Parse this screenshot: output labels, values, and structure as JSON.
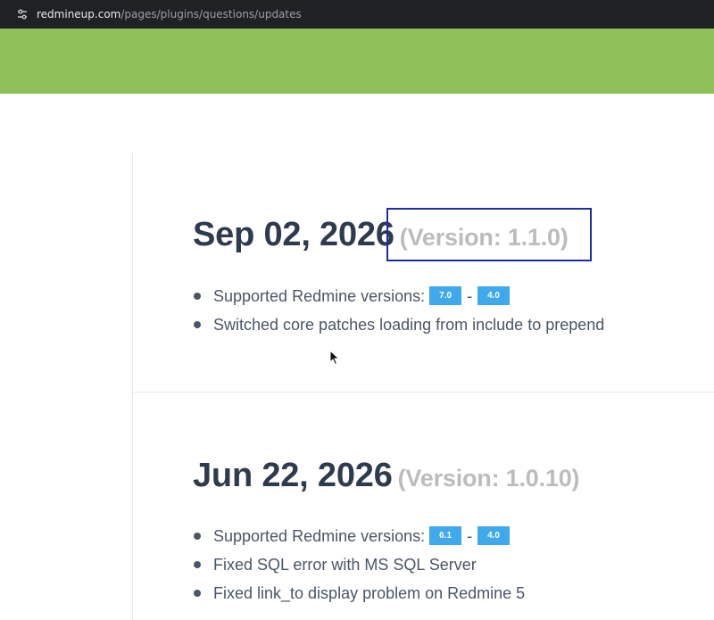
{
  "browser": {
    "url_host": "redmineup.com",
    "url_path": "/pages/plugins/questions/updates"
  },
  "entries": [
    {
      "date": "Sep 02, 2026",
      "version": "(Version: 1.1.0)",
      "supported_label": "Supported Redmine versions:",
      "version_from": "7.0",
      "version_sep": "-",
      "version_to": "4.0",
      "changes": [
        "Switched core patches loading from include to prepend"
      ]
    },
    {
      "date": "Jun 22, 2026",
      "version": "(Version: 1.0.10)",
      "supported_label": "Supported Redmine versions:",
      "version_from": "6.1",
      "version_sep": "-",
      "version_to": "4.0",
      "changes": [
        "Fixed SQL error with MS SQL Server",
        "Fixed link_to display problem on Redmine 5"
      ]
    }
  ],
  "colors": {
    "header_green": "#8fc057",
    "badge_blue": "#3fa9ec",
    "highlight_border": "#1b2fa0"
  }
}
